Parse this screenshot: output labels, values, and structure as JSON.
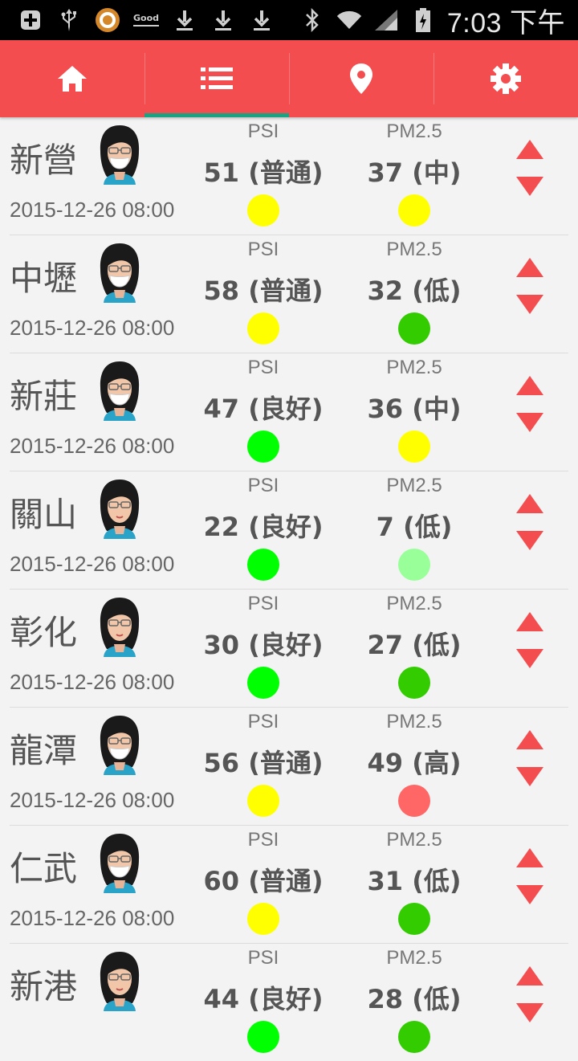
{
  "status_bar": {
    "good_label": "Good",
    "time": "7:03 下午",
    "left_icons": [
      "plus-icon",
      "usb-icon",
      "ring-app-icon",
      "good-icon",
      "download-icon",
      "download-icon",
      "download-icon"
    ],
    "right_icons": [
      "bluetooth-icon",
      "wifi-icon",
      "signal-icon",
      "battery-icon"
    ]
  },
  "toolbar": {
    "color": "#f44d4f",
    "indicator_color": "#1aa383",
    "tabs": [
      {
        "icon": "home-icon",
        "active": false
      },
      {
        "icon": "list-icon",
        "active": true
      },
      {
        "icon": "location-pin-icon",
        "active": false
      },
      {
        "icon": "gear-icon",
        "active": false
      }
    ]
  },
  "colors": {
    "good": "#00ff00",
    "moderate": "#ffff00",
    "low": "#33cc00",
    "very_low": "#99ff99",
    "high": "#ff6666"
  },
  "rows": [
    {
      "city": "新營",
      "time": "2015-12-26 08:00",
      "mask": true,
      "psi_label": "PSI",
      "psi": "51 (普通)",
      "psi_color": "#ffff00",
      "pm_label": "PM2.5",
      "pm": "37 (中)",
      "pm_color": "#ffff00"
    },
    {
      "city": "中壢",
      "time": "2015-12-26 08:00",
      "mask": true,
      "psi_label": "PSI",
      "psi": "58 (普通)",
      "psi_color": "#ffff00",
      "pm_label": "PM2.5",
      "pm": "32 (低)",
      "pm_color": "#33cc00"
    },
    {
      "city": "新莊",
      "time": "2015-12-26 08:00",
      "mask": true,
      "psi_label": "PSI",
      "psi": "47 (良好)",
      "psi_color": "#00ff00",
      "pm_label": "PM2.5",
      "pm": "36 (中)",
      "pm_color": "#ffff00"
    },
    {
      "city": "關山",
      "time": "2015-12-26 08:00",
      "mask": false,
      "psi_label": "PSI",
      "psi": "22 (良好)",
      "psi_color": "#00ff00",
      "pm_label": "PM2.5",
      "pm": "7 (低)",
      "pm_color": "#99ff99"
    },
    {
      "city": "彰化",
      "time": "2015-12-26 08:00",
      "mask": false,
      "psi_label": "PSI",
      "psi": "30 (良好)",
      "psi_color": "#00ff00",
      "pm_label": "PM2.5",
      "pm": "27 (低)",
      "pm_color": "#33cc00"
    },
    {
      "city": "龍潭",
      "time": "2015-12-26 08:00",
      "mask": true,
      "psi_label": "PSI",
      "psi": "56 (普通)",
      "psi_color": "#ffff00",
      "pm_label": "PM2.5",
      "pm": "49 (高)",
      "pm_color": "#ff6666"
    },
    {
      "city": "仁武",
      "time": "2015-12-26 08:00",
      "mask": true,
      "psi_label": "PSI",
      "psi": "60 (普通)",
      "psi_color": "#ffff00",
      "pm_label": "PM2.5",
      "pm": "31 (低)",
      "pm_color": "#33cc00"
    },
    {
      "city": "新港",
      "time": "",
      "mask": false,
      "psi_label": "PSI",
      "psi": "44 (良好)",
      "psi_color": "#00ff00",
      "pm_label": "PM2.5",
      "pm": "28 (低)",
      "pm_color": "#33cc00"
    }
  ]
}
